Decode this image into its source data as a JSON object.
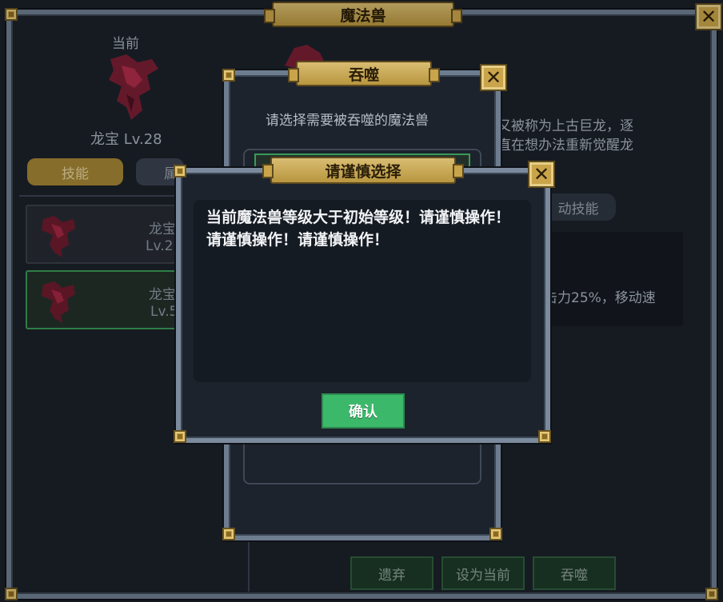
{
  "main": {
    "title": "魔法兽",
    "current_label": "当前",
    "current_name_level": "龙宝 Lv.28",
    "tabs": [
      "技能",
      "属"
    ],
    "description_fragment": "又被称为上古巨龙，逐\n直在想办法重新觉醒龙",
    "skill_tab_fragment": "动技能",
    "skill_text_fragment": "击力25%，移动速",
    "list": [
      {
        "name": "龙宝",
        "level": "Lv.2"
      },
      {
        "name": "龙宝",
        "level": "Lv.5"
      }
    ],
    "bottom_buttons": [
      "遗弃",
      "设为当前",
      "吞噬"
    ],
    "close_icon": "close-icon"
  },
  "devour_dialog": {
    "title": "吞噬",
    "prompt": "请选择需要被吞噬的魔法兽"
  },
  "confirm_dialog": {
    "title": "请谨慎选择",
    "message": "当前魔法兽等级大于初始等级！请谨慎操作！请谨慎操作！请谨慎操作！",
    "confirm_label": "确认"
  },
  "colors": {
    "gold": "#c9a44a",
    "green_button": "#3cb86a",
    "panel": "#1c232d"
  }
}
